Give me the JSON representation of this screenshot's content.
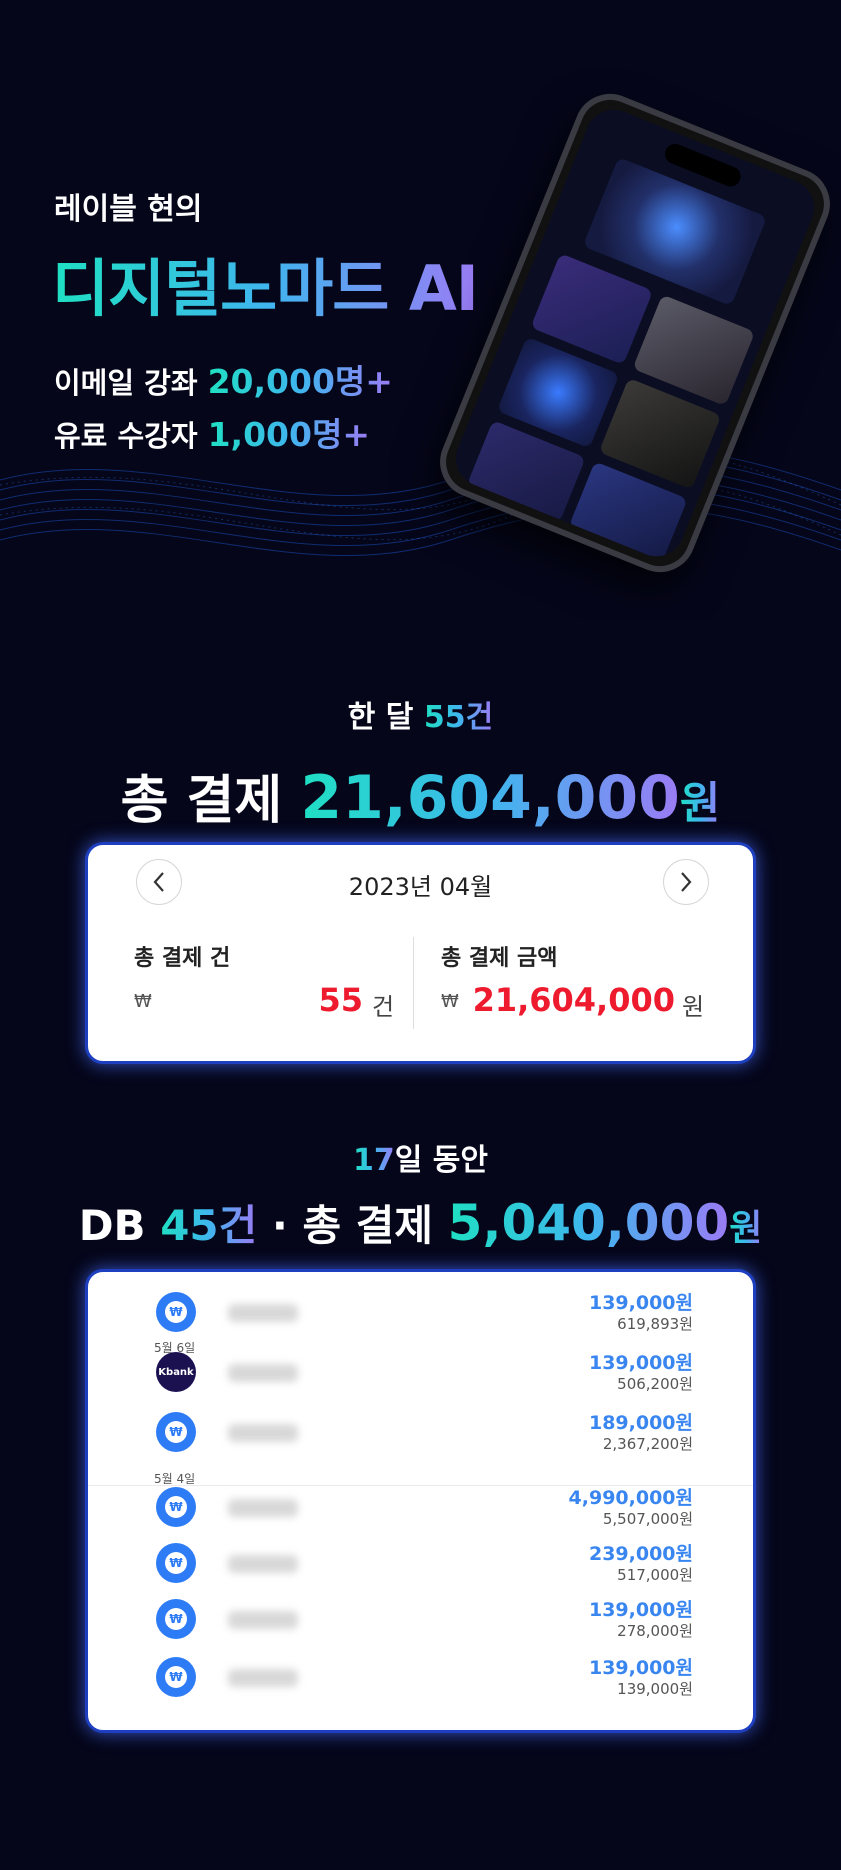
{
  "hero": {
    "subtitle": "레이블 현의",
    "title": "디지털노마드 AI",
    "line1_label": "이메일 강좌 ",
    "line1_value": "20,000명+",
    "line2_label": "유료 수강자 ",
    "line2_value": "1,000명+"
  },
  "section1": {
    "sub_prefix": "한 달 ",
    "sub_value": "55건",
    "main_label": "총 결제 ",
    "main_value": "21,604,000",
    "main_unit": "원"
  },
  "calendar": {
    "month": "2023년 04월",
    "prev_icon": "chevron-left-icon",
    "next_icon": "chevron-right-icon",
    "count_label": "총 결제 건",
    "count_symbol": "₩",
    "count_value": "55",
    "count_unit": "건",
    "amount_label": "총 결제 금액",
    "amount_symbol": "₩",
    "amount_value": "21,604,000",
    "amount_unit": "원"
  },
  "section2": {
    "sub_value": "17",
    "sub_suffix": "일 동안",
    "main_prefix": "DB ",
    "main_db_value": "45건",
    "main_sep": " · 총 결제 ",
    "main_value": "5,040,000",
    "main_unit": "원"
  },
  "transactions": {
    "date1": "5월 6일",
    "date2": "5월 4일",
    "won_icon_text": "₩",
    "kbank_text": "Kbank",
    "items": [
      {
        "amount": "139,000원",
        "balance": "619,893원",
        "icon": "won-icon"
      },
      {
        "amount": "139,000원",
        "balance": "506,200원",
        "icon": "kbank-icon"
      },
      {
        "amount": "189,000원",
        "balance": "2,367,200원",
        "icon": "won-icon"
      },
      {
        "amount": "4,990,000원",
        "balance": "5,507,000원",
        "icon": "won-icon"
      },
      {
        "amount": "239,000원",
        "balance": "517,000원",
        "icon": "won-icon"
      },
      {
        "amount": "139,000원",
        "balance": "278,000원",
        "icon": "won-icon"
      },
      {
        "amount": "139,000원",
        "balance": "139,000원",
        "icon": "won-icon"
      }
    ]
  },
  "colors": {
    "background": "#05061a",
    "gradient_start": "#1fe0c3",
    "gradient_end": "#9b7bf5",
    "amount_red": "#ee1b2e",
    "tx_blue": "#3a86f0",
    "card_glow": "#1e3fbf"
  }
}
